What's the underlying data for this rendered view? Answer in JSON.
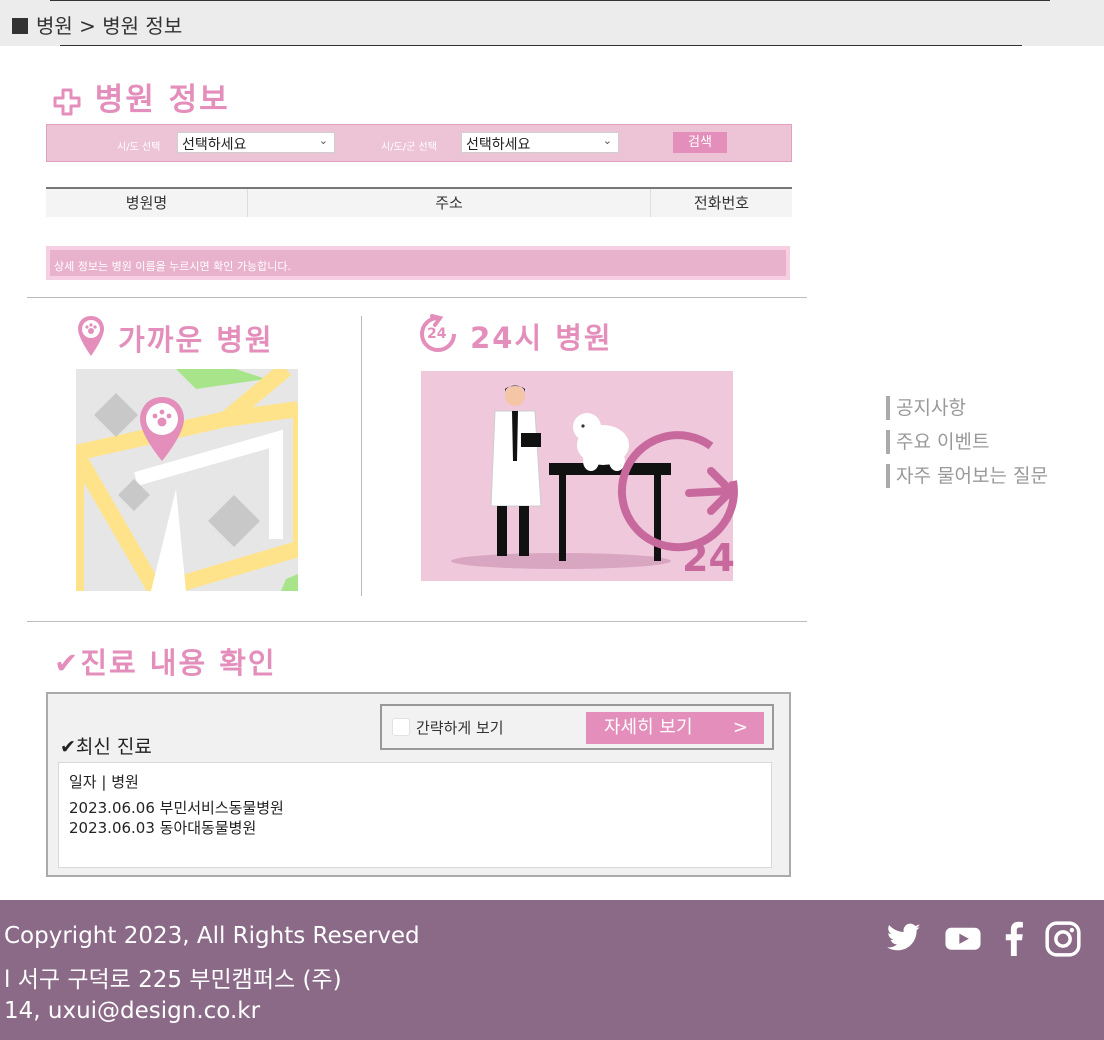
{
  "breadcrumb": {
    "text": "병원 > 병원 정보"
  },
  "hospital_info": {
    "title": "병원 정보",
    "search": {
      "city_label": "시/도 선택",
      "city_value": "선택하세요",
      "district_label": "시/도/군 선택",
      "district_value": "선택하세요",
      "button": "검색"
    },
    "table_headers": [
      "병원명",
      "주소",
      "전화번호"
    ],
    "notice": "상세 정보는 병원 이름을 누르시면 확인 가능합니다."
  },
  "nearby": {
    "title": "가까운 병원"
  },
  "h24": {
    "title": "24시 병원",
    "badge_number": "24",
    "icon_number": "24"
  },
  "side_links": [
    "공지사항",
    "주요 이벤트",
    "자주 물어보는 질문"
  ],
  "treatment": {
    "title": "진료 내용 확인",
    "simple_view_label": "간략하게 보기",
    "simple_view_checked": false,
    "detail_button": "자세히 보기",
    "detail_arrow": ">",
    "latest_label": "최신 진료",
    "records_header": "일자 | 병원",
    "records": [
      "2023.06.06 부민서비스동물병원",
      "2023.06.03 동아대동물병원"
    ]
  },
  "footer": {
    "copyright": "Copyright 2023, All Rights Reserved",
    "address": "l 서구 구덕로 225 부민캠퍼스 (주)",
    "contact": "14, uxui@design.co.kr",
    "social_icons": [
      "twitter-icon",
      "youtube-icon",
      "facebook-icon",
      "instagram-icon"
    ]
  },
  "colors": {
    "accent": "#e48fbb",
    "footer_bg": "#8b6a88",
    "search_bg": "#ecc4d6"
  }
}
